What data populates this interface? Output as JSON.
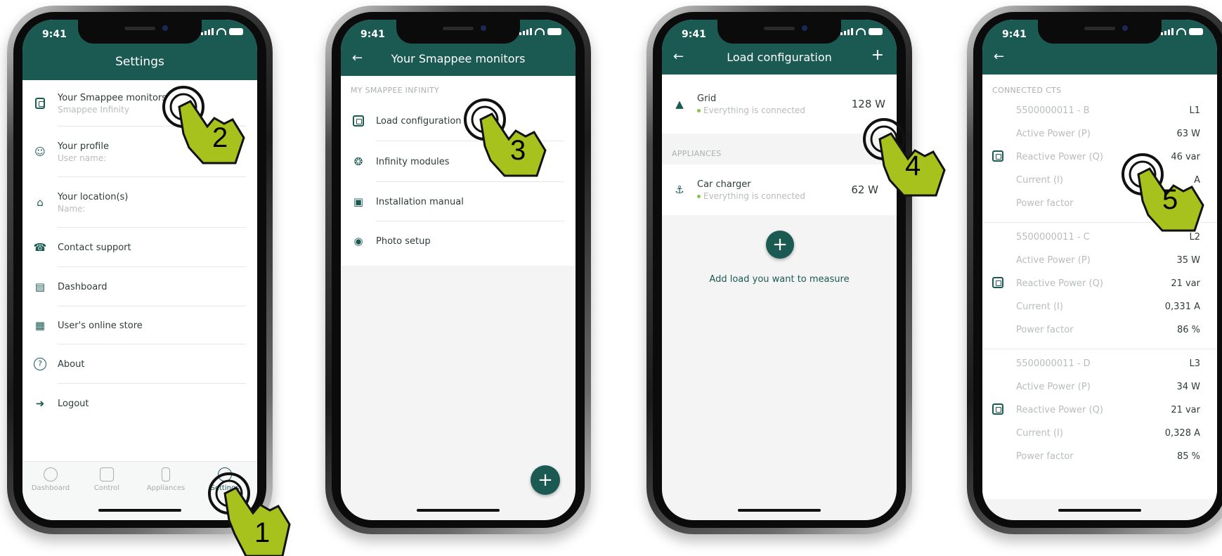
{
  "status_time": "9:41",
  "phone1": {
    "title": "Settings",
    "items": [
      {
        "label": "Your Smappee monitors",
        "sub": "Smappee Infinity"
      },
      {
        "label": "Your profile",
        "sub": "User name:"
      },
      {
        "label": "Your location(s)",
        "sub": "Name:"
      },
      {
        "label": "Contact support",
        "sub": ""
      },
      {
        "label": "Dashboard",
        "sub": ""
      },
      {
        "label": "User's online store",
        "sub": ""
      },
      {
        "label": "About",
        "sub": ""
      },
      {
        "label": "Logout",
        "sub": ""
      }
    ],
    "tabs": [
      "Dashboard",
      "Control",
      "Appliances",
      "Settings"
    ]
  },
  "phone2": {
    "title": "Your Smappee monitors",
    "section": "MY SMAPPEE INFINITY",
    "items": [
      "Load configuration",
      "Infinity modules",
      "Installation manual",
      "Photo setup"
    ],
    "fab": "+"
  },
  "phone3": {
    "title": "Load configuration",
    "plus": "+",
    "grid": {
      "name": "Grid",
      "status": "Everything is connected",
      "value": "128 W"
    },
    "section": "APPLIANCES",
    "appliance": {
      "name": "Car charger",
      "status": "Everything is connected",
      "value": "62 W"
    },
    "add_button": "+",
    "add_label": "Add load you want to measure"
  },
  "phone4": {
    "section": "CONNECTED CTS",
    "groups": [
      {
        "id": "5500000011 - B",
        "phase": "L1",
        "rows": [
          {
            "k": "Active Power (P)",
            "v": "63 W"
          },
          {
            "k": "Reactive Power (Q)",
            "v": "46 var"
          },
          {
            "k": "Current (I)",
            "v": "A"
          },
          {
            "k": "Power factor",
            "v": "%"
          }
        ]
      },
      {
        "id": "5500000011 - C",
        "phase": "L2",
        "rows": [
          {
            "k": "Active Power (P)",
            "v": "35 W"
          },
          {
            "k": "Reactive Power (Q)",
            "v": "21 var"
          },
          {
            "k": "Current (I)",
            "v": "0,331 A"
          },
          {
            "k": "Power factor",
            "v": "86 %"
          }
        ]
      },
      {
        "id": "5500000011 - D",
        "phase": "L3",
        "rows": [
          {
            "k": "Active Power (P)",
            "v": "34 W"
          },
          {
            "k": "Reactive Power (Q)",
            "v": "21 var"
          },
          {
            "k": "Current (I)",
            "v": "0,328 A"
          },
          {
            "k": "Power factor",
            "v": "85 %"
          }
        ]
      }
    ]
  },
  "steps": [
    "1",
    "2",
    "3",
    "4",
    "5"
  ],
  "colors": {
    "brand": "#1a5a53",
    "hand": "#a8c21d",
    "status_dot": "#8bc34a"
  }
}
